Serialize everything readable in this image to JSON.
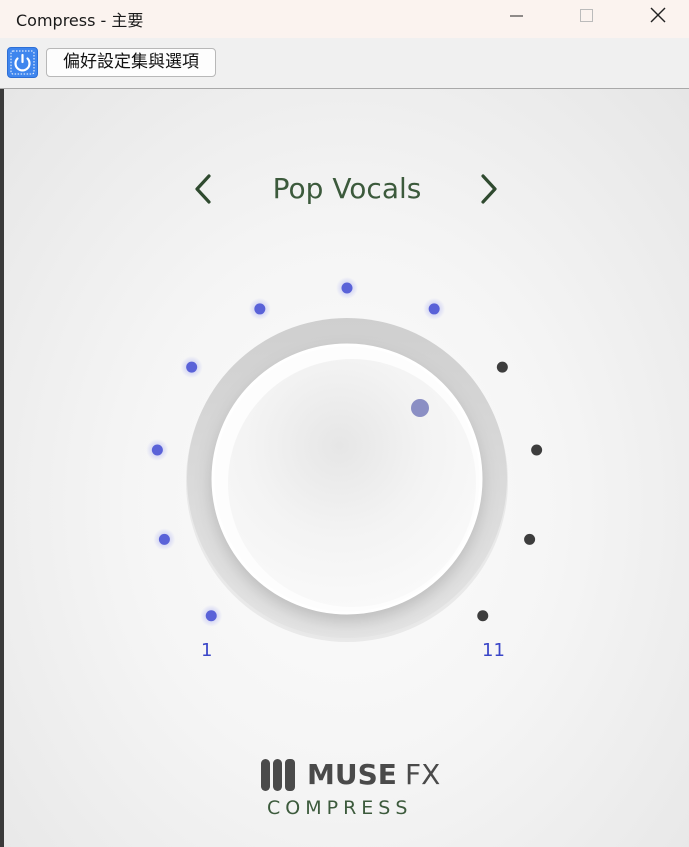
{
  "window": {
    "title": "Compress - 主要"
  },
  "toolbar": {
    "power_icon": "power-icon",
    "prefs_label": "偏好設定集與選項"
  },
  "preset": {
    "name": "Pop Vocals",
    "prev_icon": "chevron-left-icon",
    "next_icon": "chevron-right-icon"
  },
  "knob": {
    "min_label": "1",
    "max_label": "11",
    "led_count": 11,
    "lit_leds": 7,
    "lit_color": "#5a62d8",
    "unlit_color": "#3d3d3d"
  },
  "logo": {
    "brand_bold": "MUSE",
    "brand_light": "FX",
    "product": "COMPRESS",
    "text_color": "#4a4a4a",
    "accent": "#3c5a3c"
  }
}
